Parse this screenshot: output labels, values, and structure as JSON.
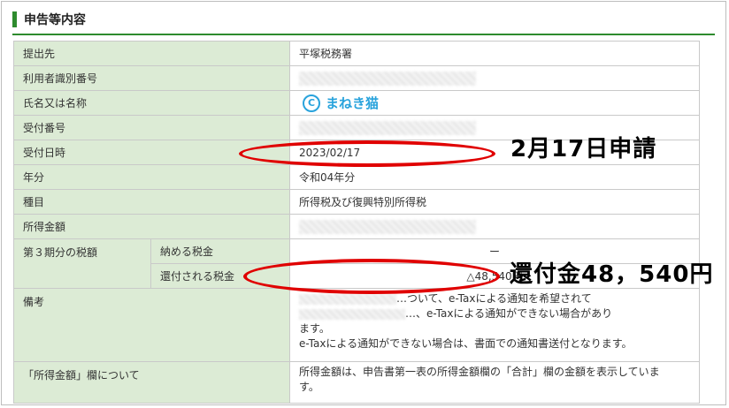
{
  "section": {
    "title": "申告等内容"
  },
  "rows": {
    "submit_to": {
      "label": "提出先",
      "value": "平塚税務署"
    },
    "user_id": {
      "label": "利用者識別番号"
    },
    "name": {
      "label": "氏名又は名称",
      "watermark": "まねき猫",
      "watermark_mark": "C"
    },
    "receipt_no": {
      "label": "受付番号"
    },
    "receipt_datetime": {
      "label": "受付日時",
      "value": "2023/02/17"
    },
    "year": {
      "label": "年分",
      "value": "令和04年分"
    },
    "category": {
      "label": "種目",
      "value": "所得税及び復興特別所得税"
    },
    "income": {
      "label": "所得金額"
    },
    "tax3": {
      "label": "第３期分の税額",
      "pay_label": "納める税金",
      "pay_value": "ー",
      "refund_label": "還付される税金",
      "refund_value": "△48,540円"
    },
    "remarks": {
      "label": "備考",
      "line1": "…ついて、e-Taxによる通知を希望されて",
      "line2": "…、e-Taxによる通知ができない場合があり",
      "line3": "ます。",
      "line4": "e-Taxによる通知ができない場合は、書面での通知書送付となります。"
    },
    "income_note": {
      "label": "「所得金額」欄について",
      "value": "所得金額は、申告書第一表の所得金額欄の「合計」欄の金額を表示していま",
      "value2": "す。"
    }
  },
  "annotations": {
    "date_note": "2月17日申請",
    "refund_note": "還付金48，540円"
  },
  "colors": {
    "accent": "#2e8b2e",
    "label_bg": "#dcebd5",
    "oval": "#e00000",
    "watermark": "#29a3dc"
  }
}
